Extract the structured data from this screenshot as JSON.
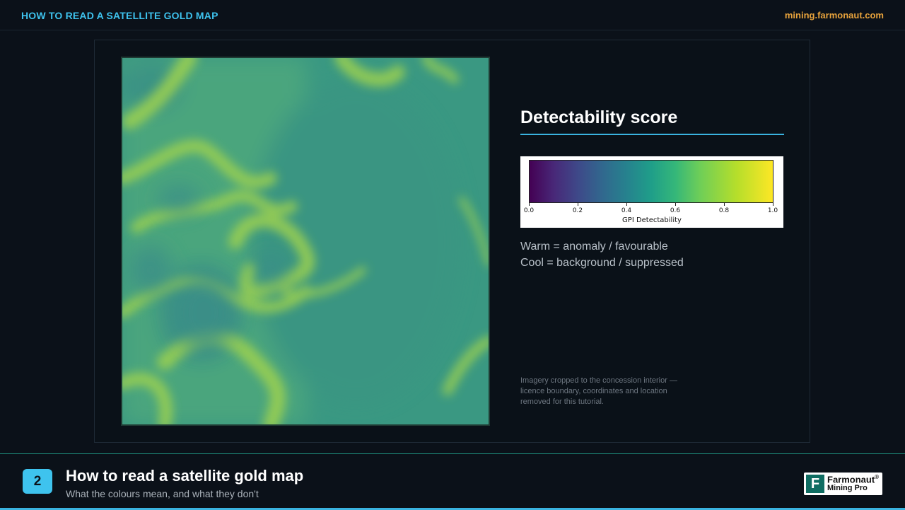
{
  "header": {
    "title": "HOW TO READ A SATELLITE GOLD MAP",
    "site": "mining.farmonaut.com"
  },
  "map": {
    "description_icon": "detectability-heatmap",
    "base_color": "#3a9a82",
    "anomaly_color": "#8ccf4e"
  },
  "legend": {
    "heading": "Detectability score",
    "colorbar": {
      "ticks": [
        "0.0",
        "0.2",
        "0.4",
        "0.6",
        "0.8",
        "1.0"
      ],
      "label": "GPI Detectability",
      "colormap": "viridis"
    },
    "warm_note": "Warm = anomaly / favourable",
    "cool_note": "Cool = background / suppressed",
    "footnote": "Imagery cropped to the concession interior — licence boundary, coordinates and location removed for this tutorial."
  },
  "footer": {
    "step_number": "2",
    "title": "How to read a satellite gold map",
    "subtitle": "What the colours mean, and what they don't",
    "logo_mark": "F",
    "logo_name": "Farmonaut",
    "logo_reg": "®",
    "logo_sub": "Mining Pro"
  },
  "colors": {
    "accent": "#3ec3ee",
    "site_link": "#e8a33c",
    "background": "#0b1119"
  }
}
